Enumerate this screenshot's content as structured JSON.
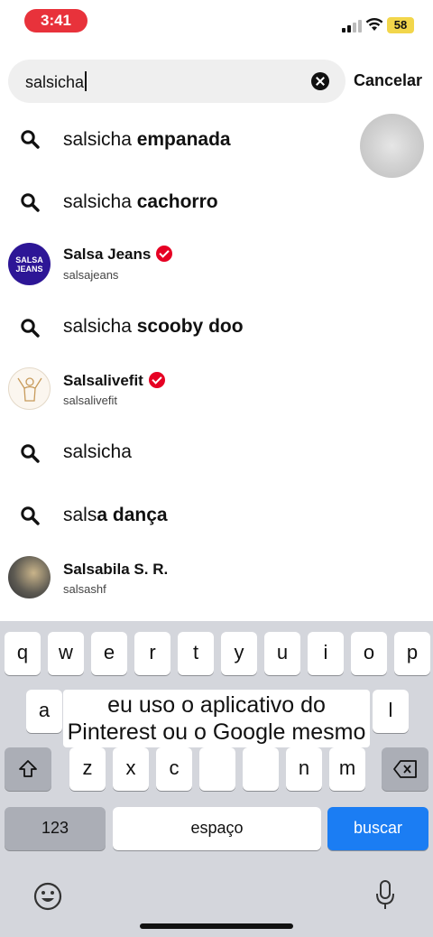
{
  "status_bar": {
    "time": "3:41",
    "battery": "58"
  },
  "search": {
    "value": "salsicha",
    "cancel_label": "Cancelar"
  },
  "suggestions": [
    {
      "type": "query",
      "typed": "salsicha",
      "completion": " empanada"
    },
    {
      "type": "query",
      "typed": "salsicha",
      "completion": " cachorro"
    },
    {
      "type": "account",
      "name": "Salsa Jeans",
      "username": "salsajeans",
      "avatar_text": "SALSA\nJEANS",
      "verified": true
    },
    {
      "type": "query",
      "typed": "salsicha",
      "completion": " scooby doo"
    },
    {
      "type": "account",
      "name": "Salsalivefit",
      "username": "salsalivefit",
      "verified": true
    },
    {
      "type": "query",
      "typed": "salsicha",
      "completion": ""
    },
    {
      "type": "query",
      "typed": "sals",
      "completion": "a dança"
    },
    {
      "type": "account",
      "name": "Salsabila S. R.",
      "username": "salsashf",
      "verified": false
    }
  ],
  "keyboard": {
    "row1": [
      "q",
      "w",
      "e",
      "r",
      "t",
      "y",
      "u",
      "i",
      "o",
      "p"
    ],
    "row2_visible": [
      "a",
      "l"
    ],
    "row3_visible": [
      "z",
      "x",
      "c",
      "n",
      "m"
    ],
    "numbers_label": "123",
    "space_label": "espaço",
    "search_label": "buscar"
  },
  "caption": "eu uso o aplicativo do Pinterest ou o Google mesmo",
  "colors": {
    "accent_blue": "#1b7df3",
    "verified_red": "#e60023",
    "time_pill": "#e8323b"
  },
  "icons": [
    "search-icon",
    "clear-icon",
    "verified-icon",
    "shift-icon",
    "backspace-icon",
    "emoji-icon",
    "microphone-icon",
    "wifi-icon",
    "signal-icon",
    "battery-icon"
  ]
}
